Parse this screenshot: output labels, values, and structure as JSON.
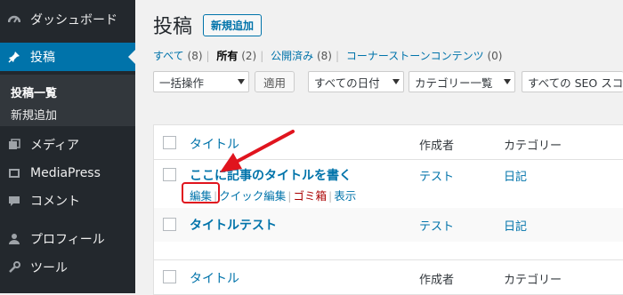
{
  "sidebar": {
    "items": [
      {
        "label": "ダッシュボード",
        "icon": "dashboard-icon"
      },
      {
        "label": "投稿",
        "icon": "pin-icon",
        "active": true
      },
      {
        "label": "メディア",
        "icon": "media-icon"
      },
      {
        "label": "MediaPress",
        "icon": "mediapress-icon"
      },
      {
        "label": "コメント",
        "icon": "comment-icon"
      },
      {
        "label": "プロフィール",
        "icon": "user-icon"
      },
      {
        "label": "ツール",
        "icon": "tools-icon"
      }
    ],
    "submenu": {
      "posts_list": "投稿一覧",
      "add_new": "新規追加"
    }
  },
  "page": {
    "title": "投稿",
    "add_new_label": "新規追加"
  },
  "filters": {
    "all": "すべて",
    "all_count": "(8)",
    "mine": "所有",
    "mine_count": "(2)",
    "published": "公開済み",
    "published_count": "(8)",
    "cornerstone": "コーナーストーンコンテンツ",
    "cornerstone_count": "(0)"
  },
  "toolbar": {
    "bulk_action": "一括操作",
    "apply": "適用",
    "all_dates": "すべての日付",
    "category_list": "カテゴリー一覧",
    "seo": "すべての SEO スコア"
  },
  "table": {
    "headers": {
      "title": "タイトル",
      "author": "作成者",
      "category": "カテゴリー"
    },
    "rows": [
      {
        "title": "ここに記事のタイトルを書く",
        "author": "テスト",
        "category": "日記",
        "actions": {
          "edit": "編集",
          "quick_edit": "クイック編集",
          "trash": "ゴミ箱",
          "view": "表示"
        }
      },
      {
        "title": "タイトルテスト",
        "author": "テスト",
        "category": "日記"
      }
    ]
  },
  "colors": {
    "sidebar_bg": "#23282d",
    "accent": "#0073aa",
    "annotation": "#e0141e"
  }
}
